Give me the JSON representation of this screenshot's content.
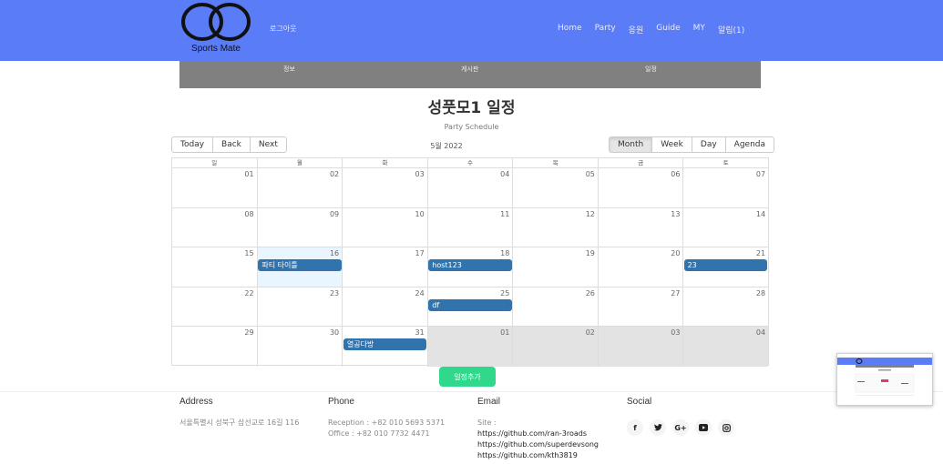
{
  "header": {
    "logo_text": "Sports Mate",
    "logout": "로그아웃",
    "nav": [
      "Home",
      "Party",
      "응원",
      "Guide",
      "MY",
      "알림(1)"
    ]
  },
  "subtabs": [
    "정보",
    "게시판",
    "일정"
  ],
  "title": "성풋모1 일정",
  "subtitle": "Party Schedule",
  "toolbar": {
    "left": [
      "Today",
      "Back",
      "Next"
    ],
    "label": "5월 2022",
    "right": [
      "Month",
      "Week",
      "Day",
      "Agenda"
    ],
    "active_view": "Month"
  },
  "calendar": {
    "weekdays": [
      "일",
      "월",
      "화",
      "수",
      "목",
      "금",
      "토"
    ],
    "weeks": [
      [
        "01",
        "02",
        "03",
        "04",
        "05",
        "06",
        "07"
      ],
      [
        "08",
        "09",
        "10",
        "11",
        "12",
        "13",
        "14"
      ],
      [
        "15",
        "16",
        "17",
        "18",
        "19",
        "20",
        "21"
      ],
      [
        "22",
        "23",
        "24",
        "25",
        "26",
        "27",
        "28"
      ],
      [
        "29",
        "30",
        "31",
        "01",
        "02",
        "03",
        "04"
      ]
    ],
    "off_range_cells": [
      [
        4,
        3
      ],
      [
        4,
        4
      ],
      [
        4,
        5
      ],
      [
        4,
        6
      ]
    ],
    "highlighted_cell": [
      2,
      1
    ],
    "events": [
      {
        "week": 2,
        "day": 1,
        "title": "파티 타이틀"
      },
      {
        "week": 2,
        "day": 3,
        "title": "host123"
      },
      {
        "week": 2,
        "day": 6,
        "title": "23"
      },
      {
        "week": 3,
        "day": 3,
        "title": "df"
      },
      {
        "week": 4,
        "day": 2,
        "title": "열공다방"
      }
    ],
    "event_color": "#3174ad"
  },
  "add_button": "일정추가",
  "footer": {
    "address": {
      "heading": "Address",
      "text": "서울특별시 성북구 삼선교로 16길 116"
    },
    "phone": {
      "heading": "Phone",
      "lines": [
        "Reception : +82 010 5693 5371",
        "Office : +82 010 7732 4471"
      ]
    },
    "email": {
      "heading": "Email",
      "label": "Site :",
      "links": [
        "https://github.com/ran-3roads",
        "https://github.com/superdevsong",
        "https://github.com/kth3819"
      ]
    },
    "social": {
      "heading": "Social",
      "icons": [
        "facebook-icon",
        "twitter-icon",
        "google-plus-icon",
        "youtube-icon",
        "instagram-icon"
      ]
    }
  },
  "colors": {
    "navbar": "#5b7cf7",
    "subtabs": "#808080",
    "add_button": "#2fd88b"
  }
}
